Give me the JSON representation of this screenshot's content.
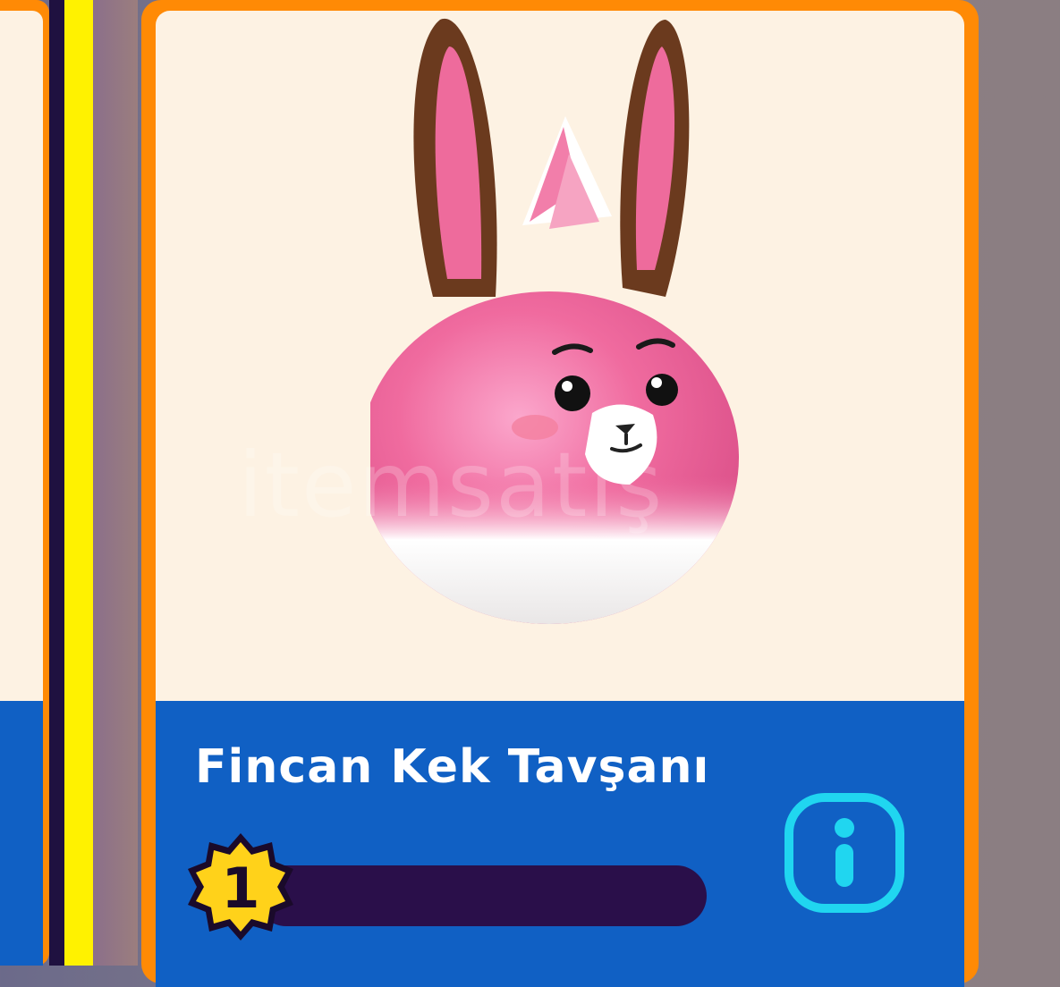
{
  "item": {
    "name": "Fincan Kek Tavşanı",
    "level": "1",
    "level_progress": 0
  },
  "watermark": "itemsatış",
  "icons": {
    "character": "pink-bunny-character",
    "info": "info-icon",
    "level": "level-star-badge"
  },
  "colors": {
    "card_border": "#ff8a05",
    "card_image_bg": "#fdf2e3",
    "card_footer_bg": "#1060c4",
    "level_bar": "#2a0f4a",
    "badge": "#ffd21a",
    "info": "#20d6f0"
  }
}
